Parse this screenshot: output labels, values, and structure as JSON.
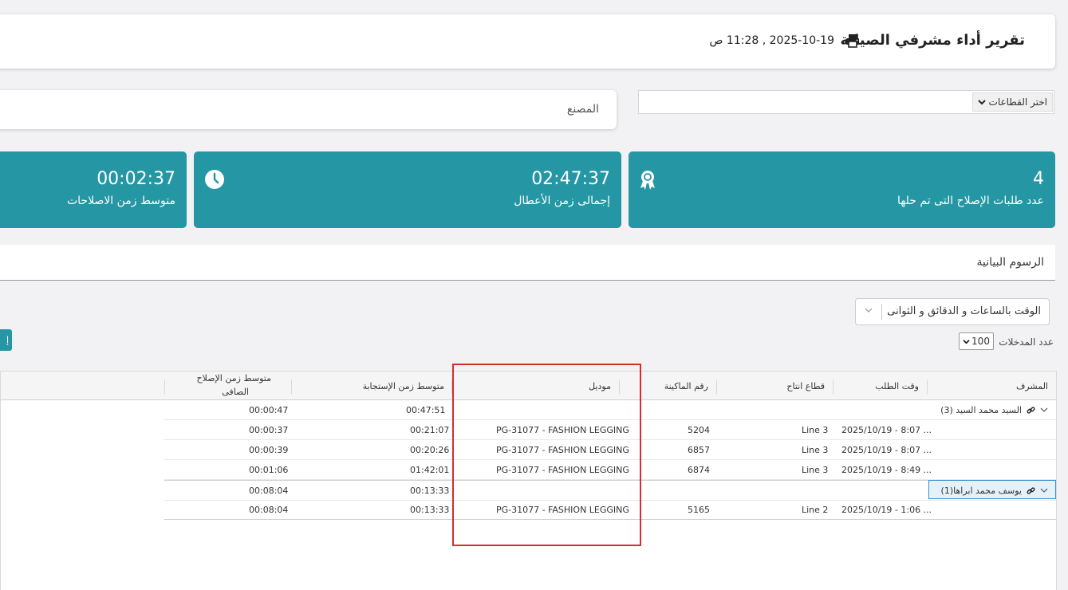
{
  "header": {
    "title": "تقرير أداء مشرفي الصيانة",
    "datetime": "2025-10-19 , 11:28 ص"
  },
  "filters": {
    "sector_placeholder": "اختر القطاعات",
    "factory_label": "المصنع"
  },
  "stats": [
    {
      "value": "4",
      "label": "عدد طلبات الإصلاح التى تم حلها",
      "icon": "award-icon"
    },
    {
      "value": "02:47:37",
      "label": "إجمالى زمن الأعطال",
      "icon": "clock-icon"
    },
    {
      "value": "00:02:37",
      "label": "متوسط زمن الاصلاحات",
      "icon": ""
    }
  ],
  "charts_label": "الرسوم البيانية",
  "time_format_select": "الوقت بالساعات و الدقائق و الثوانى",
  "entries": {
    "label": "عدد المدخلات",
    "value": "100"
  },
  "side_button_label": "إ",
  "table": {
    "headers": {
      "supervisor": "المشرف",
      "request_time": "وقت الطلب",
      "sector": "قطاع انتاج",
      "machine": "رقم الماكينة",
      "model": "موديل",
      "response": "متوسط زمن الإستجابة",
      "repair_line1": "متوسط زمن الإصلاح",
      "repair_line2": "الصافى"
    },
    "groups": [
      {
        "name": "السيد محمد السيد (3)",
        "response": "00:47:51",
        "repair": "00:00:47"
      },
      {
        "name": "يوسف محمد ابراها(1)",
        "response": "00:13:33",
        "repair": "00:08:04"
      }
    ],
    "rows": [
      {
        "time": "2025/10/19 - 8:07 ...",
        "sector": "Line 3",
        "machine": "5204",
        "model": "PG-31077 - FASHION LEGGING",
        "response": "00:21:07",
        "repair": "00:00:37"
      },
      {
        "time": "2025/10/19 - 8:07 ...",
        "sector": "Line 3",
        "machine": "6857",
        "model": "PG-31077 - FASHION LEGGING",
        "response": "00:20:26",
        "repair": "00:00:39"
      },
      {
        "time": "2025/10/19 - 8:49 ...",
        "sector": "Line 3",
        "machine": "6874",
        "model": "PG-31077 - FASHION LEGGING",
        "response": "01:42:01",
        "repair": "00:01:06"
      },
      {
        "time": "2025/10/19 - 1:06 ...",
        "sector": "Line 2",
        "machine": "5165",
        "model": "PG-31077 - FASHION LEGGING",
        "response": "00:13:33",
        "repair": "00:08:04"
      }
    ]
  },
  "colors": {
    "accent": "#2596a3",
    "highlight_border": "#d32f2f",
    "selected_row": "#e4f1f8"
  }
}
